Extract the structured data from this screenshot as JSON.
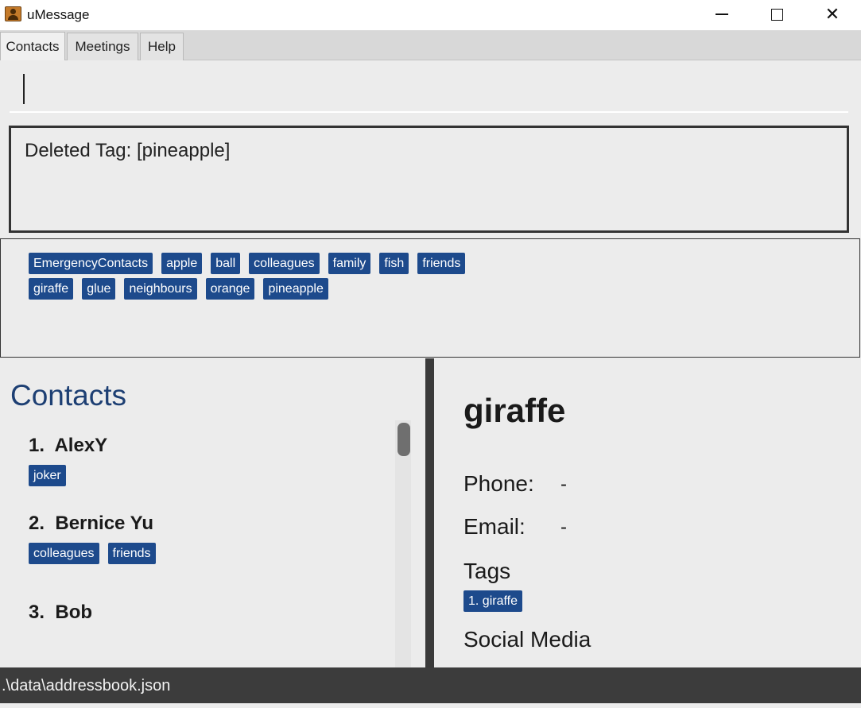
{
  "window": {
    "title": "uMessage",
    "icon": "contacts-book-icon",
    "minimize_icon": "minimize-icon",
    "maximize_icon": "maximize-icon",
    "close_glyph": "✕"
  },
  "tabs": [
    {
      "label": "Contacts",
      "active": true
    },
    {
      "label": "Meetings",
      "active": false
    },
    {
      "label": "Help",
      "active": false
    }
  ],
  "command": {
    "value": "",
    "placeholder": ""
  },
  "result": {
    "message": "Deleted Tag: [pineapple]"
  },
  "tag_panel": {
    "row1": [
      "EmergencyContacts",
      "apple",
      "ball",
      "colleagues",
      "family",
      "fish",
      "friends"
    ],
    "row2": [
      "giraffe",
      "glue",
      "neighbours",
      "orange",
      "pineapple"
    ]
  },
  "contacts": {
    "title": "Contacts",
    "items": [
      {
        "index": "1.",
        "name": "AlexY",
        "tags": [
          "joker"
        ]
      },
      {
        "index": "2.",
        "name": "Bernice Yu",
        "tags": [
          "colleagues",
          "friends"
        ]
      },
      {
        "index": "3.",
        "name": "Bob",
        "tags": []
      }
    ]
  },
  "detail": {
    "name": "giraffe",
    "phone_label": "Phone:",
    "phone_value": "-",
    "email_label": "Email:",
    "email_value": "-",
    "tags_label": "Tags",
    "tags": [
      "1. giraffe"
    ],
    "social_label": "Social Media"
  },
  "status": {
    "path": ".\\data\\addressbook.json"
  },
  "colors": {
    "tag_bg": "#1d4a8c",
    "contacts_title": "#1d3f73",
    "status_bar": "#3c3c3c",
    "panel_bg": "#ececec"
  }
}
